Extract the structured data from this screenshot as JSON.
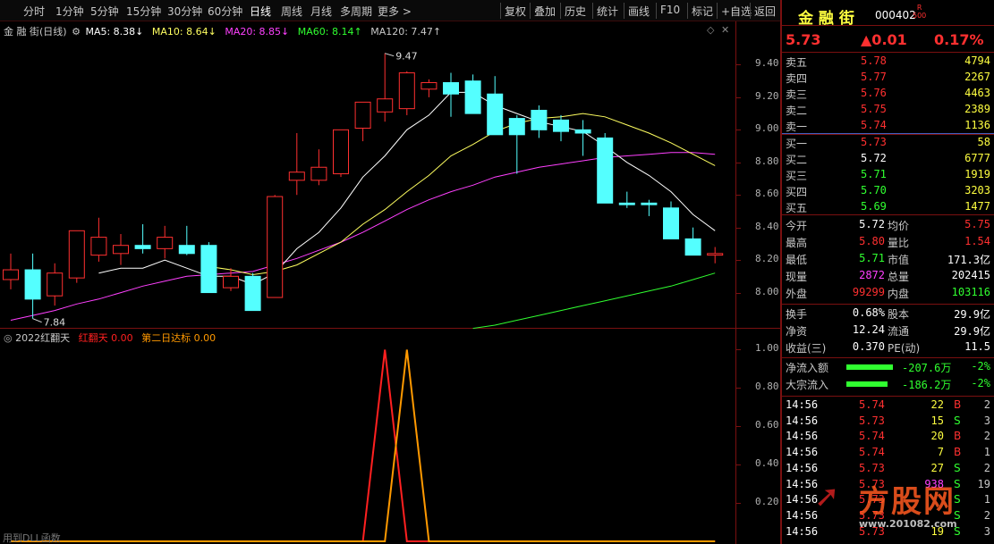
{
  "toolbar": {
    "periods": [
      "分时",
      "1分钟",
      "5分钟",
      "15分钟",
      "30分钟",
      "60分钟",
      "日线",
      "周线",
      "月线",
      "多周期",
      "更多 >"
    ],
    "active_period": "日线",
    "buttons": [
      "复权",
      "叠加",
      "历史",
      "统计",
      "画线",
      "F10",
      "标记",
      "+自选",
      "返回"
    ]
  },
  "chart_legend": {
    "title": "金 融 街(日线)",
    "ma5": "MA5: 8.38↓",
    "ma10": "MA10: 8.64↓",
    "ma20": "MA20: 8.85↓",
    "ma60": "MA60: 8.14↑",
    "ma120": "MA120: 7.47↑"
  },
  "colors": {
    "up": "#ff3030",
    "down": "#54ffff",
    "ma5": "#ffffff",
    "ma10": "#ffff60",
    "ma20": "#ff40ff",
    "ma60": "#30ff30",
    "ind_red": "#ff2020",
    "ind_orange": "#ff9900",
    "border": "#7a1010"
  },
  "chart_data": [
    {
      "type": "candlestick",
      "ylim": [
        7.8,
        9.6
      ],
      "yticks": [
        "9.40",
        "9.20",
        "9.00",
        "8.80",
        "8.60",
        "8.40",
        "8.20",
        "8.00"
      ],
      "annotations": {
        "high": "9.47",
        "low": "7.84"
      },
      "candles": [
        {
          "o": 8.08,
          "h": 8.24,
          "l": 8.02,
          "c": 8.14
        },
        {
          "o": 8.14,
          "h": 8.24,
          "l": 7.84,
          "c": 7.96
        },
        {
          "o": 7.98,
          "h": 8.18,
          "l": 7.92,
          "c": 8.12
        },
        {
          "o": 8.09,
          "h": 8.38,
          "l": 8.06,
          "c": 8.38
        },
        {
          "o": 8.23,
          "h": 8.46,
          "l": 8.19,
          "c": 8.34
        },
        {
          "o": 8.24,
          "h": 8.36,
          "l": 8.17,
          "c": 8.29
        },
        {
          "o": 8.29,
          "h": 8.42,
          "l": 8.24,
          "c": 8.27
        },
        {
          "o": 8.27,
          "h": 8.41,
          "l": 8.21,
          "c": 8.34
        },
        {
          "o": 8.29,
          "h": 8.41,
          "l": 8.23,
          "c": 8.24
        },
        {
          "o": 8.29,
          "h": 8.31,
          "l": 8.0,
          "c": 8.0
        },
        {
          "o": 8.03,
          "h": 8.15,
          "l": 8.01,
          "c": 8.1
        },
        {
          "o": 8.1,
          "h": 8.12,
          "l": 7.89,
          "c": 7.89
        },
        {
          "o": 7.97,
          "h": 8.6,
          "l": 7.97,
          "c": 8.59
        },
        {
          "o": 8.69,
          "h": 8.98,
          "l": 8.6,
          "c": 8.74
        },
        {
          "o": 8.69,
          "h": 8.88,
          "l": 8.66,
          "c": 8.77
        },
        {
          "o": 8.73,
          "h": 9.0,
          "l": 8.71,
          "c": 9.0
        },
        {
          "o": 9.01,
          "h": 9.13,
          "l": 8.93,
          "c": 9.17
        },
        {
          "o": 9.11,
          "h": 9.47,
          "l": 9.05,
          "c": 9.19
        },
        {
          "o": 9.13,
          "h": 9.36,
          "l": 9.09,
          "c": 9.35
        },
        {
          "o": 9.25,
          "h": 9.31,
          "l": 9.2,
          "c": 9.29
        },
        {
          "o": 9.29,
          "h": 9.35,
          "l": 9.08,
          "c": 9.22
        },
        {
          "o": 9.3,
          "h": 9.34,
          "l": 9.1,
          "c": 9.1
        },
        {
          "o": 9.22,
          "h": 9.33,
          "l": 9.05,
          "c": 8.97
        },
        {
          "o": 9.07,
          "h": 9.09,
          "l": 8.73,
          "c": 8.97
        },
        {
          "o": 9.12,
          "h": 9.15,
          "l": 8.95,
          "c": 9.0
        },
        {
          "o": 9.06,
          "h": 9.09,
          "l": 8.93,
          "c": 8.99
        },
        {
          "o": 9.0,
          "h": 9.06,
          "l": 8.84,
          "c": 8.98
        },
        {
          "o": 8.95,
          "h": 8.98,
          "l": 8.55,
          "c": 8.55
        },
        {
          "o": 8.55,
          "h": 8.62,
          "l": 8.52,
          "c": 8.54
        },
        {
          "o": 8.55,
          "h": 8.57,
          "l": 8.47,
          "c": 8.54
        },
        {
          "o": 8.52,
          "h": 8.56,
          "l": 8.33,
          "c": 8.33
        },
        {
          "o": 8.33,
          "h": 8.4,
          "l": 8.23,
          "c": 8.23
        },
        {
          "o": 8.23,
          "h": 8.28,
          "l": 8.18,
          "c": 8.24
        }
      ],
      "ma5": [
        null,
        null,
        null,
        null,
        8.12,
        8.15,
        8.15,
        8.2,
        8.15,
        8.1,
        8.1,
        8.05,
        8.12,
        8.27,
        8.37,
        8.52,
        8.71,
        8.84,
        9.0,
        9.09,
        9.23,
        9.23,
        9.15,
        9.1,
        9.05,
        9.02,
        8.99,
        8.9,
        8.8,
        8.72,
        8.62,
        8.48,
        8.38
      ],
      "ma10": [
        null,
        null,
        null,
        null,
        null,
        null,
        null,
        null,
        null,
        8.16,
        8.14,
        8.11,
        8.13,
        8.17,
        8.24,
        8.31,
        8.42,
        8.51,
        8.62,
        8.72,
        8.84,
        8.91,
        8.99,
        9.04,
        9.07,
        9.08,
        9.1,
        9.08,
        9.03,
        8.98,
        8.92,
        8.85,
        8.78
      ],
      "ma20": [
        7.83,
        7.86,
        7.89,
        7.93,
        7.96,
        8.0,
        8.04,
        8.07,
        8.1,
        8.11,
        8.12,
        8.13,
        8.17,
        8.21,
        8.26,
        8.31,
        8.37,
        8.44,
        8.51,
        8.57,
        8.62,
        8.66,
        8.71,
        8.74,
        8.77,
        8.79,
        8.81,
        8.83,
        8.84,
        8.85,
        8.86,
        8.86,
        8.85
      ],
      "ma60": [
        null,
        null,
        null,
        null,
        null,
        null,
        null,
        null,
        null,
        null,
        null,
        null,
        null,
        null,
        null,
        null,
        null,
        null,
        null,
        null,
        null,
        7.78,
        7.8,
        7.83,
        7.86,
        7.89,
        7.92,
        7.95,
        7.98,
        8.01,
        8.04,
        8.08,
        8.12
      ]
    },
    {
      "type": "line",
      "title": "2022红翻天",
      "ylim": [
        0,
        1.1
      ],
      "yticks": [
        "1.00",
        "0.80",
        "0.60",
        "0.40",
        "0.20"
      ],
      "series": [
        {
          "name": "红翻天",
          "value_label": "0.00",
          "values": [
            0,
            0,
            0,
            0,
            0,
            0,
            0,
            0,
            0,
            0,
            0,
            0,
            0,
            0,
            0,
            0,
            0,
            1,
            0,
            0,
            0,
            0,
            0,
            0,
            0,
            0,
            0,
            0,
            0,
            0,
            0,
            0,
            0
          ]
        },
        {
          "name": "第二日达标",
          "value_label": "0.00",
          "values": [
            0,
            0,
            0,
            0,
            0,
            0,
            0,
            0,
            0,
            0,
            0,
            0,
            0,
            0,
            0,
            0,
            0,
            0,
            1,
            0,
            0,
            0,
            0,
            0,
            0,
            0,
            0,
            0,
            0,
            0,
            0,
            0,
            0
          ]
        }
      ],
      "footer": "用到DLL函数"
    }
  ],
  "quote": {
    "name": "金 融 街",
    "code": "000402",
    "badge_r": "R",
    "badge_n": "500",
    "price": "5.73",
    "change": "▲0.01",
    "pct": "0.17%",
    "sells": [
      {
        "label": "卖五",
        "price": "5.78",
        "vol": "4794"
      },
      {
        "label": "卖四",
        "price": "5.77",
        "vol": "2267"
      },
      {
        "label": "卖三",
        "price": "5.76",
        "vol": "4463"
      },
      {
        "label": "卖二",
        "price": "5.75",
        "vol": "2389"
      },
      {
        "label": "卖一",
        "price": "5.74",
        "vol": "1136"
      }
    ],
    "buys": [
      {
        "label": "买一",
        "price": "5.73",
        "vol": "58"
      },
      {
        "label": "买二",
        "price": "5.72",
        "vol": "6777"
      },
      {
        "label": "买三",
        "price": "5.71",
        "vol": "1919"
      },
      {
        "label": "买四",
        "price": "5.70",
        "vol": "3203"
      },
      {
        "label": "买五",
        "price": "5.69",
        "vol": "1477"
      }
    ],
    "stats1": [
      {
        "l1": "今开",
        "v1": "5.72",
        "l2": "均价",
        "v2": "5.75"
      },
      {
        "l1": "最高",
        "v1": "5.80",
        "l2": "量比",
        "v2": "1.54"
      },
      {
        "l1": "最低",
        "v1": "5.71",
        "l2": "市值",
        "v2": "171.3亿"
      },
      {
        "l1": "现量",
        "v1": "2872",
        "l2": "总量",
        "v2": "202415"
      },
      {
        "l1": "外盘",
        "v1": "99299",
        "l2": "内盘",
        "v2": "103116"
      }
    ],
    "stats2": [
      {
        "l1": "换手",
        "v1": "0.68%",
        "l2": "股本",
        "v2": "29.9亿"
      },
      {
        "l1": "净资",
        "v1": "12.24",
        "l2": "流通",
        "v2": "29.9亿"
      },
      {
        "l1": "收益(三)",
        "v1": "0.370",
        "l2": "PE(动)",
        "v2": "11.5"
      }
    ],
    "flows": [
      {
        "label": "净流入额",
        "value": "-207.6万",
        "pct": "-2%"
      },
      {
        "label": "大宗流入",
        "value": "-186.2万",
        "pct": "-2%"
      }
    ],
    "ticks": [
      {
        "t": "14:56",
        "p": "5.74",
        "v": "22",
        "s": "B",
        "n": "2"
      },
      {
        "t": "14:56",
        "p": "5.73",
        "v": "15",
        "s": "S",
        "n": "3"
      },
      {
        "t": "14:56",
        "p": "5.74",
        "v": "20",
        "s": "B",
        "n": "2"
      },
      {
        "t": "14:56",
        "p": "5.74",
        "v": "7",
        "s": "B",
        "n": "1"
      },
      {
        "t": "14:56",
        "p": "5.73",
        "v": "27",
        "s": "S",
        "n": "2"
      },
      {
        "t": "14:56",
        "p": "5.73",
        "v": "938",
        "s": "S",
        "n": "19"
      },
      {
        "t": "14:56",
        "p": "5.73",
        "v": "",
        "s": "S",
        "n": "1"
      },
      {
        "t": "14:56",
        "p": "5.73",
        "v": "",
        "s": "S",
        "n": "2"
      },
      {
        "t": "14:56",
        "p": "5.73",
        "v": "19",
        "s": "S",
        "n": "3"
      }
    ],
    "watermark_cn": "方股网",
    "watermark_url": "www.201082.com"
  }
}
